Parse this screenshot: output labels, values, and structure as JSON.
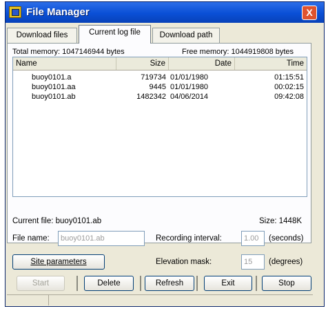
{
  "window": {
    "title": "File Manager",
    "close_glyph": "X",
    "app_icon": "file-manager-icon"
  },
  "tabs": [
    {
      "label": "Download files"
    },
    {
      "label": "Current log file",
      "active": true
    },
    {
      "label": "Download path"
    }
  ],
  "memory": {
    "total": "Total memory: 1047146944 bytes",
    "free": "Free memory: 1044919808 bytes"
  },
  "files": {
    "columns": [
      "Name",
      "Size",
      "Date",
      "Time"
    ],
    "rows": [
      {
        "name": "buoy0101.a",
        "size": "719734",
        "date": "01/01/1980",
        "time": "01:15:51"
      },
      {
        "name": "buoy0101.aa",
        "size": "9445",
        "date": "01/01/1980",
        "time": "00:02:15"
      },
      {
        "name": "buoy0101.ab",
        "size": "1482342",
        "date": "04/06/2014",
        "time": "09:42:08"
      }
    ]
  },
  "current": {
    "file_label": "Current file: buoy0101.ab",
    "size_label": "Size: 1448K"
  },
  "form": {
    "file_name_label": "File name:",
    "file_name_value": "buoy0101.ab",
    "recording_label": "Recording interval:",
    "recording_value": "1.00",
    "recording_unit": "(seconds)",
    "site_button": "Site parameters",
    "elevation_label": "Elevation mask:",
    "elevation_value": "15",
    "elevation_unit": "(degrees)"
  },
  "buttons": {
    "start": "Start",
    "delete": "Delete",
    "refresh": "Refresh",
    "exit": "Exit",
    "stop": "Stop"
  },
  "colors": {
    "titlebar": "#0a4fd6",
    "close": "#e0532e",
    "window": "#ece9d8"
  }
}
